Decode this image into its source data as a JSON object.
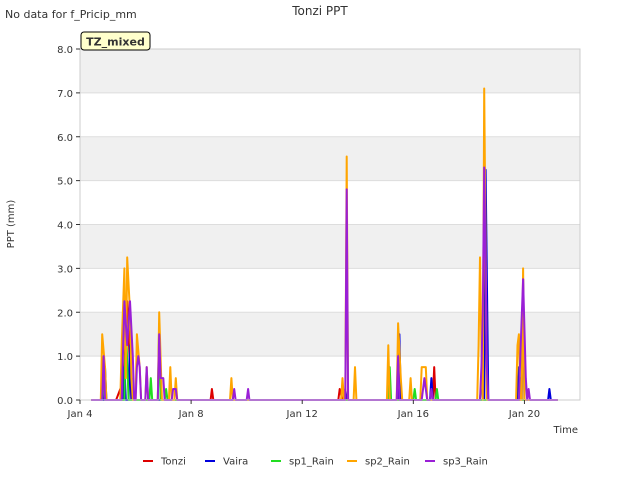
{
  "top_note": "No data for f_Pricip_mm",
  "badge": "TZ_mixed",
  "colors": {
    "Tonzi": "#dd0000",
    "Vaira": "#0000dd",
    "sp1_Rain": "#22dd22",
    "sp2_Rain": "#ffa500",
    "sp3_Rain": "#9a1fd6",
    "band": "#f0f0f0",
    "badge_bg": "#ffffcc",
    "badge_text": "#990000"
  },
  "chart_data": {
    "type": "line",
    "title": "Tonzi PPT",
    "xlabel": "Time",
    "ylabel": "PPT (mm)",
    "xlim": [
      4.0,
      22.0
    ],
    "ylim": [
      0.0,
      8.0
    ],
    "x_ticks": [
      {
        "v": 4,
        "label": "Jan 4"
      },
      {
        "v": 8,
        "label": "Jan 8"
      },
      {
        "v": 12,
        "label": "Jan 12"
      },
      {
        "v": 16,
        "label": "Jan 16"
      },
      {
        "v": 20,
        "label": "Jan 20"
      }
    ],
    "y_ticks": [
      0.0,
      1.0,
      2.0,
      3.0,
      4.0,
      5.0,
      6.0,
      7.0,
      8.0
    ],
    "y_tick_labels": [
      "0.0",
      "1.0",
      "2.0",
      "3.0",
      "4.0",
      "5.0",
      "6.0",
      "7.0",
      "8.0"
    ],
    "grid": true,
    "legend_position": "bottom",
    "series": [
      {
        "name": "Tonzi",
        "color": "#dd0000",
        "points": [
          [
            4.4,
            0
          ],
          [
            5.3,
            0
          ],
          [
            5.45,
            0.25
          ],
          [
            5.55,
            0
          ],
          [
            5.7,
            2.25
          ],
          [
            5.85,
            0
          ],
          [
            8.7,
            0
          ],
          [
            8.75,
            0.25
          ],
          [
            8.8,
            0
          ],
          [
            13.3,
            0
          ],
          [
            13.35,
            0.25
          ],
          [
            13.45,
            0
          ],
          [
            16.7,
            0
          ],
          [
            16.75,
            0.75
          ],
          [
            16.8,
            0
          ],
          [
            21.2,
            0
          ]
        ]
      },
      {
        "name": "Vaira",
        "color": "#0000dd",
        "points": [
          [
            4.4,
            0
          ],
          [
            4.85,
            0
          ],
          [
            4.9,
            0.75
          ],
          [
            4.95,
            0
          ],
          [
            5.55,
            0
          ],
          [
            5.6,
            0.75
          ],
          [
            5.65,
            0
          ],
          [
            5.75,
            0
          ],
          [
            5.8,
            1.25
          ],
          [
            5.85,
            0
          ],
          [
            13.5,
            0
          ],
          [
            13.55,
            0.25
          ],
          [
            13.6,
            0
          ],
          [
            15.45,
            0
          ],
          [
            15.5,
            1.5
          ],
          [
            15.55,
            0
          ],
          [
            16.6,
            0
          ],
          [
            16.65,
            0.5
          ],
          [
            16.7,
            0
          ],
          [
            18.4,
            0
          ],
          [
            18.5,
            0.75
          ],
          [
            18.55,
            0
          ],
          [
            18.6,
            5.25
          ],
          [
            18.7,
            0
          ],
          [
            19.75,
            0
          ],
          [
            19.8,
            0.75
          ],
          [
            19.85,
            0
          ],
          [
            19.9,
            0
          ],
          [
            19.95,
            2.75
          ],
          [
            20.0,
            0
          ],
          [
            20.85,
            0
          ],
          [
            20.9,
            0.25
          ],
          [
            20.95,
            0
          ],
          [
            21.2,
            0
          ]
        ]
      },
      {
        "name": "sp1_Rain",
        "color": "#22dd22",
        "points": [
          [
            4.4,
            0
          ],
          [
            4.8,
            0
          ],
          [
            4.85,
            0.5
          ],
          [
            4.9,
            0
          ],
          [
            5.6,
            0
          ],
          [
            5.65,
            1.75
          ],
          [
            5.75,
            0
          ],
          [
            6.5,
            0
          ],
          [
            6.55,
            0.5
          ],
          [
            6.6,
            0
          ],
          [
            6.8,
            0
          ],
          [
            6.85,
            1.75
          ],
          [
            6.9,
            0
          ],
          [
            7.05,
            0
          ],
          [
            7.1,
            0.25
          ],
          [
            7.15,
            0
          ],
          [
            15.1,
            0
          ],
          [
            15.15,
            0.75
          ],
          [
            15.2,
            0
          ],
          [
            16.0,
            0
          ],
          [
            16.05,
            0.25
          ],
          [
            16.1,
            0
          ],
          [
            16.8,
            0
          ],
          [
            16.85,
            0.25
          ],
          [
            16.9,
            0
          ],
          [
            19.8,
            0
          ],
          [
            19.85,
            0.5
          ],
          [
            19.9,
            0
          ],
          [
            21.2,
            0
          ]
        ]
      },
      {
        "name": "sp2_Rain",
        "color": "#ffa500",
        "points": [
          [
            4.4,
            0
          ],
          [
            4.75,
            0
          ],
          [
            4.8,
            1.5
          ],
          [
            4.9,
            0.75
          ],
          [
            4.95,
            0
          ],
          [
            5.45,
            0
          ],
          [
            5.5,
            1.25
          ],
          [
            5.6,
            3.0
          ],
          [
            5.65,
            0.5
          ],
          [
            5.7,
            3.25
          ],
          [
            5.8,
            2.0
          ],
          [
            5.85,
            0.5
          ],
          [
            5.9,
            0
          ],
          [
            6.0,
            0
          ],
          [
            6.05,
            1.5
          ],
          [
            6.15,
            0.75
          ],
          [
            6.2,
            0
          ],
          [
            6.35,
            0
          ],
          [
            6.4,
            0.75
          ],
          [
            6.45,
            0
          ],
          [
            6.8,
            0
          ],
          [
            6.85,
            2.0
          ],
          [
            6.95,
            0
          ],
          [
            7.2,
            0
          ],
          [
            7.25,
            0.75
          ],
          [
            7.3,
            0
          ],
          [
            7.4,
            0
          ],
          [
            7.45,
            0.5
          ],
          [
            7.5,
            0
          ],
          [
            9.4,
            0
          ],
          [
            9.45,
            0.5
          ],
          [
            9.5,
            0
          ],
          [
            13.4,
            0
          ],
          [
            13.45,
            0.5
          ],
          [
            13.5,
            0
          ],
          [
            13.55,
            0
          ],
          [
            13.6,
            5.55
          ],
          [
            13.65,
            0
          ],
          [
            13.85,
            0
          ],
          [
            13.9,
            0.75
          ],
          [
            13.95,
            0
          ],
          [
            15.05,
            0
          ],
          [
            15.1,
            1.25
          ],
          [
            15.15,
            0
          ],
          [
            15.4,
            0
          ],
          [
            15.45,
            1.75
          ],
          [
            15.55,
            0.5
          ],
          [
            15.6,
            0
          ],
          [
            15.85,
            0
          ],
          [
            15.9,
            0.5
          ],
          [
            15.95,
            0
          ],
          [
            16.25,
            0
          ],
          [
            16.3,
            0.75
          ],
          [
            16.45,
            0.75
          ],
          [
            16.5,
            0
          ],
          [
            18.3,
            0
          ],
          [
            18.35,
            1.25
          ],
          [
            18.4,
            3.25
          ],
          [
            18.45,
            1.25
          ],
          [
            18.5,
            0
          ],
          [
            18.55,
            7.1
          ],
          [
            18.65,
            0
          ],
          [
            19.7,
            0
          ],
          [
            19.75,
            1.25
          ],
          [
            19.8,
            1.5
          ],
          [
            19.85,
            0
          ],
          [
            19.9,
            0
          ],
          [
            19.95,
            3.0
          ],
          [
            20.0,
            0
          ],
          [
            21.2,
            0
          ]
        ]
      },
      {
        "name": "sp3_Rain",
        "color": "#9a1fd6",
        "points": [
          [
            4.4,
            0
          ],
          [
            4.8,
            0
          ],
          [
            4.85,
            1.0
          ],
          [
            4.9,
            0
          ],
          [
            5.5,
            0
          ],
          [
            5.6,
            2.25
          ],
          [
            5.7,
            1.25
          ],
          [
            5.8,
            2.25
          ],
          [
            5.9,
            1.0
          ],
          [
            5.95,
            0
          ],
          [
            6.0,
            0
          ],
          [
            6.05,
            0.75
          ],
          [
            6.1,
            1.0
          ],
          [
            6.15,
            0.75
          ],
          [
            6.2,
            0
          ],
          [
            6.35,
            0
          ],
          [
            6.4,
            0.75
          ],
          [
            6.45,
            0
          ],
          [
            6.8,
            0
          ],
          [
            6.85,
            1.5
          ],
          [
            6.9,
            0.5
          ],
          [
            7.0,
            0.5
          ],
          [
            7.05,
            0
          ],
          [
            7.3,
            0
          ],
          [
            7.35,
            0.25
          ],
          [
            7.45,
            0.25
          ],
          [
            7.5,
            0
          ],
          [
            9.5,
            0
          ],
          [
            9.55,
            0.25
          ],
          [
            9.6,
            0
          ],
          [
            10.0,
            0
          ],
          [
            10.05,
            0.25
          ],
          [
            10.1,
            0
          ],
          [
            13.55,
            0
          ],
          [
            13.6,
            4.8
          ],
          [
            13.65,
            0
          ],
          [
            15.4,
            0
          ],
          [
            15.45,
            1.0
          ],
          [
            15.5,
            0
          ],
          [
            16.3,
            0
          ],
          [
            16.4,
            0.5
          ],
          [
            16.5,
            0
          ],
          [
            16.6,
            0
          ],
          [
            16.65,
            0.25
          ],
          [
            16.7,
            0
          ],
          [
            18.4,
            0
          ],
          [
            18.45,
            0.75
          ],
          [
            18.5,
            2.0
          ],
          [
            18.55,
            5.3
          ],
          [
            18.65,
            0.75
          ],
          [
            18.7,
            0
          ],
          [
            19.8,
            0
          ],
          [
            19.85,
            1.0
          ],
          [
            19.95,
            2.75
          ],
          [
            20.05,
            0.5
          ],
          [
            20.1,
            0
          ],
          [
            20.15,
            0.25
          ],
          [
            20.2,
            0
          ],
          [
            21.2,
            0
          ]
        ]
      }
    ]
  }
}
